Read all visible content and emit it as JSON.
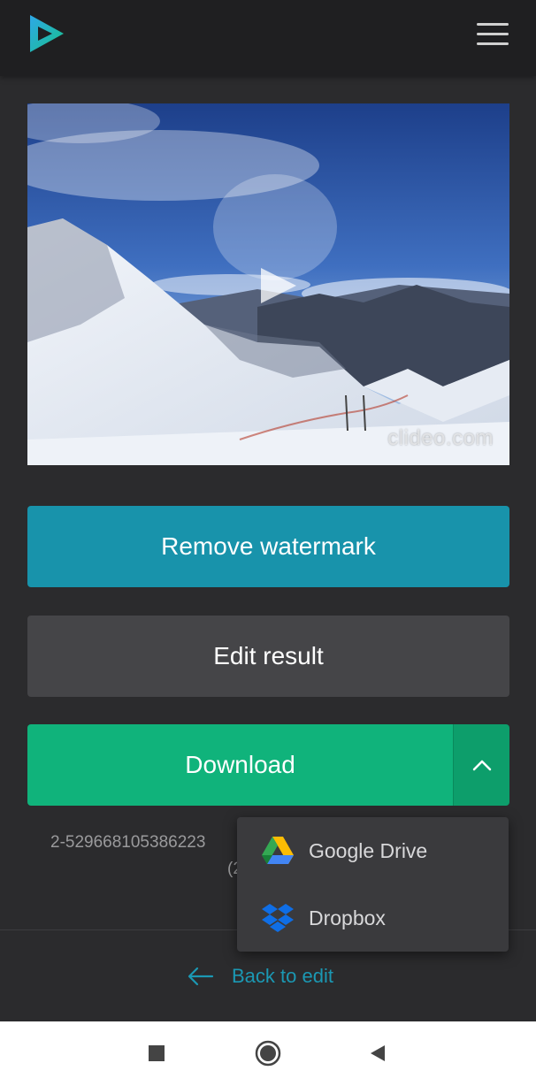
{
  "header": {
    "logo_icon": "clideo-play-logo-icon",
    "menu_icon": "hamburger-menu-icon"
  },
  "video": {
    "watermark": "clideo.com",
    "play_icon": "play-icon"
  },
  "actions": {
    "remove_watermark_label": "Remove watermark",
    "edit_result_label": "Edit result",
    "download_label": "Download",
    "download_toggle_icon": "chevron-up-icon"
  },
  "file": {
    "name": "2-529668105386223",
    "size": "(2"
  },
  "dropdown": {
    "items": [
      {
        "label": "Google Drive",
        "icon": "google-drive-icon"
      },
      {
        "label": "Dropbox",
        "icon": "dropbox-icon"
      }
    ]
  },
  "footer": {
    "back_label": "Back to edit",
    "back_icon": "arrow-left-icon"
  },
  "system_nav": {
    "recents_icon": "square-icon",
    "home_icon": "circle-home-icon",
    "back_icon": "triangle-back-icon"
  },
  "colors": {
    "background": "#2b2b2d",
    "header": "#1f1f21",
    "remove_watermark": "#1893ab",
    "edit_result": "#454548",
    "download": "#10b37b",
    "link": "#1b98b3"
  }
}
